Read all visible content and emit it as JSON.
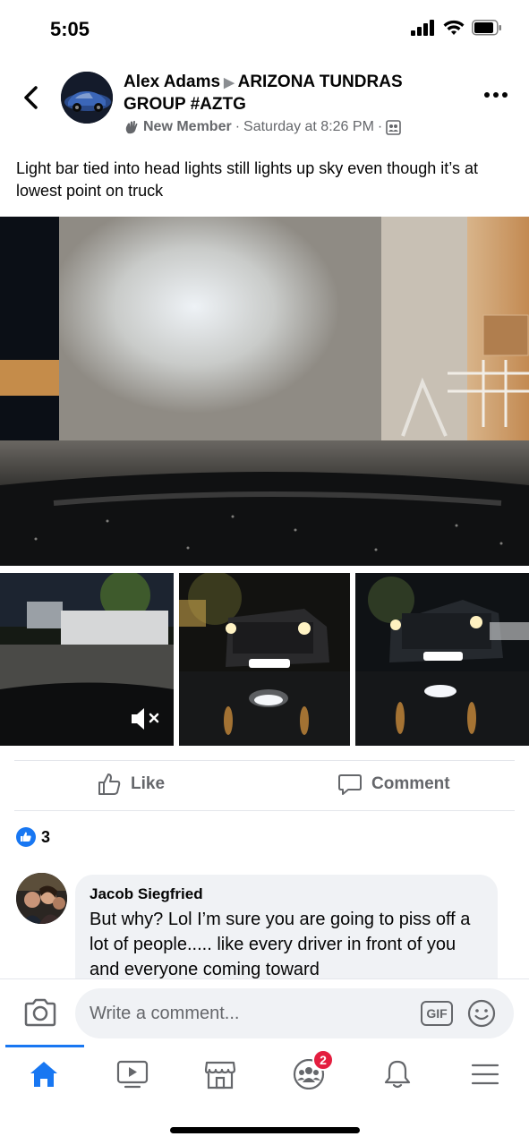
{
  "status_bar": {
    "time": "5:05"
  },
  "post": {
    "author": "Alex Adams",
    "group": "ARIZONA TUNDRAS GROUP #AZTG",
    "member_badge": "New Member",
    "timestamp": "Saturday at 8:26 PM",
    "text": "Light bar tied into head lights still lights up sky even though it’s at lowest point on truck"
  },
  "actions": {
    "like": "Like",
    "comment": "Comment"
  },
  "reactions": {
    "count": "3"
  },
  "comment": {
    "author": "Jacob Siegfried",
    "text": "But why? Lol I’m sure you are going to piss off a lot of people..... like every driver in front of you and everyone coming toward"
  },
  "composer": {
    "placeholder": "Write a comment...",
    "gif_label": "GIF"
  },
  "tabbar": {
    "groups_badge": "2"
  },
  "colors": {
    "accent": "#1877f2",
    "badge": "#e41e3f",
    "muted": "#65676b"
  },
  "icons": [
    "back-icon",
    "more-icon",
    "world-icon",
    "like-icon",
    "comment-icon",
    "camera-icon",
    "gif-icon",
    "emoji-icon",
    "home-icon",
    "video-icon",
    "marketplace-icon",
    "groups-icon",
    "bell-icon",
    "menu-icon",
    "mute-icon"
  ]
}
